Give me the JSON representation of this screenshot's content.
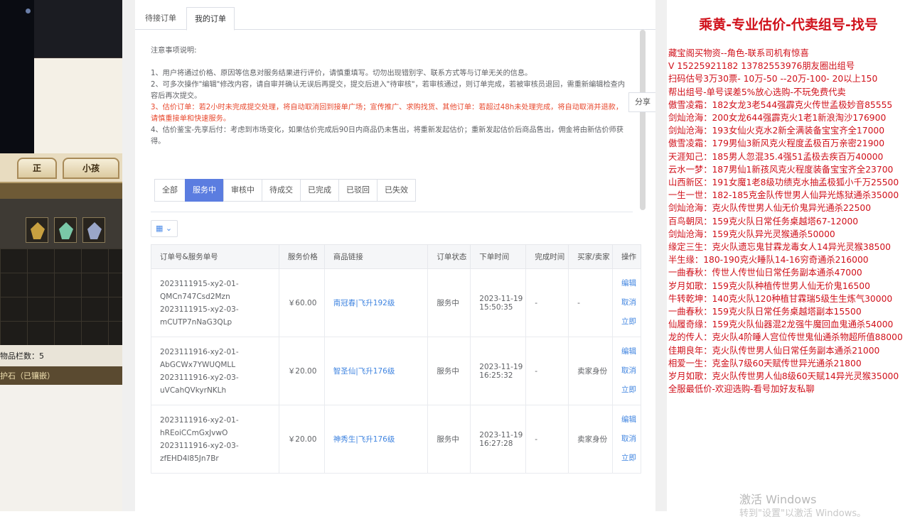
{
  "game": {
    "tab1": "正",
    "tab2": "小孩",
    "item_count": "物品栏数：5",
    "status_line": "护石（已镶嵌）"
  },
  "browser": {
    "tabs": [
      "待接订单",
      "我的订单"
    ],
    "notes_title": "注意事项说明:",
    "notes": [
      "1、用户将通过价格、原因等信息对服务结果进行评价，请慎重填写。切勿出现错别字、联系方式等与订单无关的信息。",
      "2、可多次操作\"编辑\"修改内容，请自审并确认无误后再提交，提交后进入\"待审核\"，若审核通过，则订单完成，若被审核员退回，需重新编辑检查内容后再次提交。",
      "3、估价订单：若2小时未完成提交处理，将自动取消回到接单广场；宣传推广、求购找货、其他订单：若超过48h未处理完成，将自动取消并退款，请慎重接单和快速服务。",
      "4、估价鉴宝-先享后付：考虑到市场变化，如果估价完成后90日内商品仍未售出，将重新发起估价；重新发起估价后商品售出，佣金将由新估价师获得。"
    ],
    "share": "分享",
    "status_tabs": [
      "全部",
      "服务中",
      "审核中",
      "待成交",
      "已完成",
      "已驳回",
      "已失效"
    ],
    "active_status": "服务中",
    "columns": [
      "订单号&服务单号",
      "服务价格",
      "商品链接",
      "订单状态",
      "下单时间",
      "完成时间",
      "买家/卖家",
      "操作"
    ],
    "rows": [
      {
        "order1": "2023111915-xy2-01-",
        "order2": "QMCn747Csd2Mzn",
        "order3": "2023111915-xy2-03-",
        "order4": "mCUTP7nNaG3QLp",
        "price": "￥60.00",
        "link": "南冠春|飞升192级",
        "status": "服务中",
        "date": "2023-11-19",
        "time": "15:50:35",
        "done": "-",
        "role": "-",
        "ops": [
          "编辑",
          "取消",
          "立即"
        ]
      },
      {
        "order1": "2023111916-xy2-01-",
        "order2": "AbGCWx7YWUQMLL",
        "order3": "2023111916-xy2-03-",
        "order4": "uVCahQVkyrNKLh",
        "price": "￥20.00",
        "link": "智圣仙|飞升176级",
        "status": "服务中",
        "date": "2023-11-19",
        "time": "16:25:32",
        "done": "-",
        "role": "卖家身份",
        "ops": [
          "编辑",
          "取消",
          "立即"
        ]
      },
      {
        "order1": "2023111916-xy2-01-",
        "order2": "hREoiCCmGxJvwO",
        "order3": "2023111916-xy2-03-",
        "order4": "zfEHD4l85Jn7Br",
        "price": "￥20.00",
        "link": "神秀生|飞升176级",
        "status": "服务中",
        "date": "2023-11-19",
        "time": "16:27:28",
        "done": "-",
        "role": "卖家身份",
        "ops": [
          "编辑",
          "取消",
          "立即"
        ]
      }
    ]
  },
  "overlay": {
    "title": "乘黄-专业估价-代卖组号-找号",
    "lines": [
      "藏宝阁买物资--角色-联系司机有惊喜",
      "V 15225921182  13782553976朋友圈出组号",
      "扫码估号3万30票- 10万-50 --20万-100- 20以上150",
      "帮出组号-单号误差5%放心选购-不玩免费代卖",
      "傲雪凌霜：182女龙3老544强霹克火传世孟极妙音85555",
      "剑灿沧海：200女龙644强霹克火1老1新浪淘沙176900",
      "剑灿沧海：193女仙火克水2新全满装备宝宝齐全17000",
      "傲雪凌霜：179男仙3新风克火程度孟极百万亲密21900",
      "天涯知己：185男人忽混35.4强51孟极去疾百万40000",
      "云水一梦：187男仙1新孩风克火程度装备宝宝齐全23700",
      "山西新区：191女魔1老8级功绩克水抽孟极狐小千万25500",
      "一生一世：182-185克金队传世男人仙异光炼狱通杀35000",
      "剑灿沧海：克火队传世男人仙无价鬼异光通杀22500",
      "百鸟朝凤：159克火队日常任务桌越塔67-12000",
      "剑灿沧海：159克火队异光灵猴通杀50000",
      "缘定三生：克火队遗忘鬼甘霖龙毒女人14异光灵猴38500",
      "半生缘：180-190克火睡队14-16穷奇通杀216000",
      "一曲春秋：传世人传世仙日常任务副本通杀47000",
      "岁月如歌：159克火队种植传世男人仙无价鬼16500",
      "牛转乾坤：140克火队120种植甘霖瑞5级生生炼气30000",
      "一曲春秋：159克火队日常任务桌越塔副本15500",
      "仙履奇缘：159克火队仙器混2龙强牛魔回血鬼通杀54000",
      "龙的传人：克火队4阶睡人宫位传世鬼仙通杀物超所值88000",
      "佳期良年：克火队传世男人仙日常任务副本通杀21000",
      "相爱一生：克金队7级60天赋传世异光通杀21800",
      "岁月如歌：克火队传世男人仙8级60天赋14异光灵猴35000",
      "全服最低价-欢迎选购-看号加好友私聊"
    ],
    "watermark": "激活 Windows",
    "watermark2": "转到\"设置\"以激活 Windows。"
  }
}
